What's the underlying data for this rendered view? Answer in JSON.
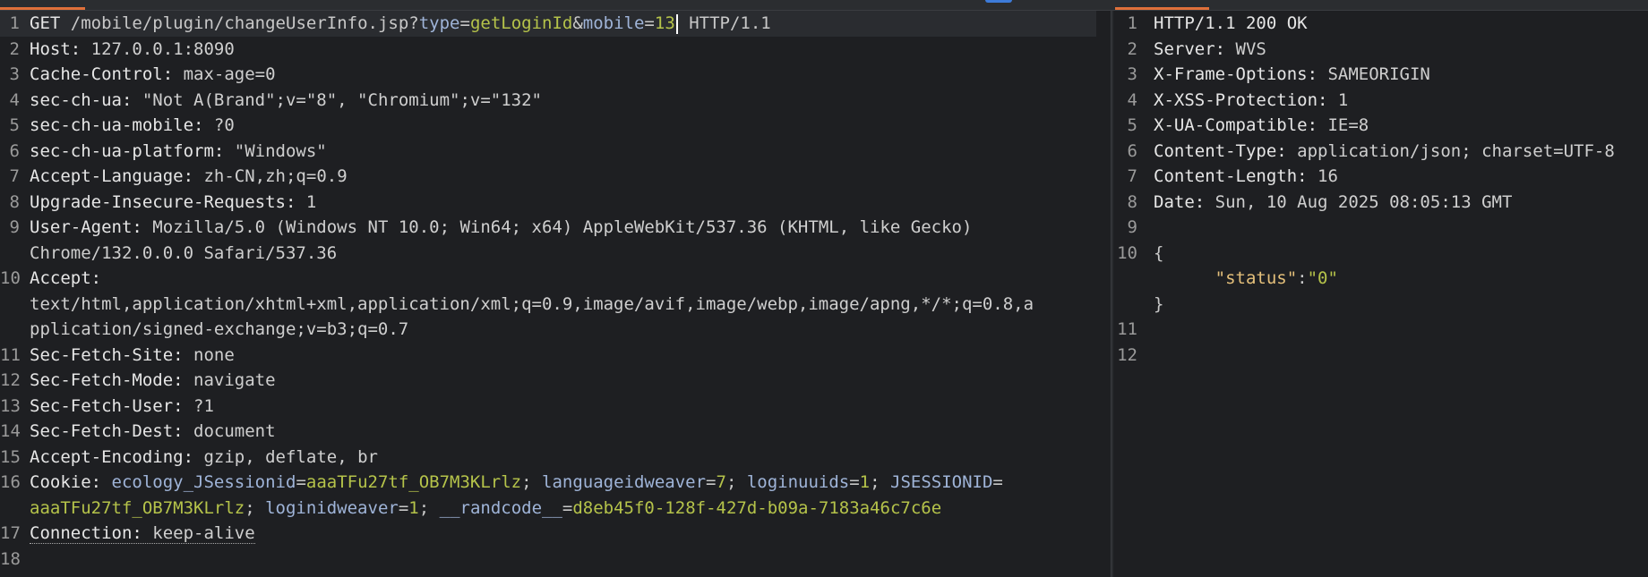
{
  "request": {
    "lines": [
      {
        "n": "1",
        "method": "GET",
        "path": "/mobile/plugin/changeUserInfo.jsp?",
        "p1k": "type",
        "p1v": "getLoginId",
        "p2k": "mobile",
        "p2v": "13",
        "proto": "HTTP/1.1"
      },
      {
        "n": "2",
        "name": "Host",
        "value": "127.0.0.1:8090"
      },
      {
        "n": "3",
        "name": "Cache-Control",
        "value": "max-age=0"
      },
      {
        "n": "4",
        "name": "sec-ch-ua",
        "value": "\"Not A(Brand\";v=\"8\", \"Chromium\";v=\"132\""
      },
      {
        "n": "5",
        "name": "sec-ch-ua-mobile",
        "value": "?0"
      },
      {
        "n": "6",
        "name": "sec-ch-ua-platform",
        "value": "\"Windows\""
      },
      {
        "n": "7",
        "name": "Accept-Language",
        "value": "zh-CN,zh;q=0.9"
      },
      {
        "n": "8",
        "name": "Upgrade-Insecure-Requests",
        "value": "1"
      },
      {
        "n": "9",
        "name": "User-Agent",
        "value": "Mozilla/5.0 (Windows NT 10.0; Win64; x64) AppleWebKit/537.36 (KHTML, like Gecko)",
        "cont": "Chrome/132.0.0.0 Safari/537.36"
      },
      {
        "n": "10",
        "name": "Accept",
        "value": "",
        "cont1": "text/html,application/xhtml+xml,application/xml;q=0.9,image/avif,image/webp,image/apng,*/*;q=0.8,a",
        "cont2": "pplication/signed-exchange;v=b3;q=0.7"
      },
      {
        "n": "11",
        "name": "Sec-Fetch-Site",
        "value": "none"
      },
      {
        "n": "12",
        "name": "Sec-Fetch-Mode",
        "value": "navigate"
      },
      {
        "n": "13",
        "name": "Sec-Fetch-User",
        "value": "?1"
      },
      {
        "n": "14",
        "name": "Sec-Fetch-Dest",
        "value": "document"
      },
      {
        "n": "15",
        "name": "Accept-Encoding",
        "value": "gzip, deflate, br"
      },
      {
        "n": "16",
        "name": "Cookie",
        "c1k": "ecology_JSessionid",
        "c1v": "aaaTFu27tf_OB7M3KLrlz",
        "c2k": "languageidweaver",
        "c2v": "7",
        "c3k": "loginuuids",
        "c3v": "1",
        "c4k": "JSESSIONID",
        "c4v": "aaaTFu27tf_OB7M3KLrlz",
        "c5k": "loginidweaver",
        "c5v": "1",
        "c6k": "__randcode__",
        "c6v": "d8eb45f0-128f-427d-b09a-7183a46c7c6e"
      },
      {
        "n": "17",
        "name": "Connection",
        "value": "keep-alive"
      },
      {
        "n": "18"
      }
    ]
  },
  "response": {
    "lines": [
      {
        "n": "1",
        "status": "HTTP/1.1 200 OK"
      },
      {
        "n": "2",
        "name": "Server",
        "value": "WVS"
      },
      {
        "n": "3",
        "name": "X-Frame-Options",
        "value": "SAMEORIGIN"
      },
      {
        "n": "4",
        "name": "X-XSS-Protection",
        "value": "1"
      },
      {
        "n": "5",
        "name": "X-UA-Compatible",
        "value": "IE=8"
      },
      {
        "n": "6",
        "name": "Content-Type",
        "value": "application/json; charset=UTF-8"
      },
      {
        "n": "7",
        "name": "Content-Length",
        "value": "16"
      },
      {
        "n": "8",
        "name": "Date",
        "value": "Sun, 10 Aug 2025 08:05:13 GMT"
      },
      {
        "n": "9"
      },
      {
        "n": "10",
        "open": "{",
        "jkey": "\"status\"",
        "jval": "\"0\"",
        "close": "}"
      },
      {
        "n": "11"
      },
      {
        "n": "12"
      }
    ]
  }
}
